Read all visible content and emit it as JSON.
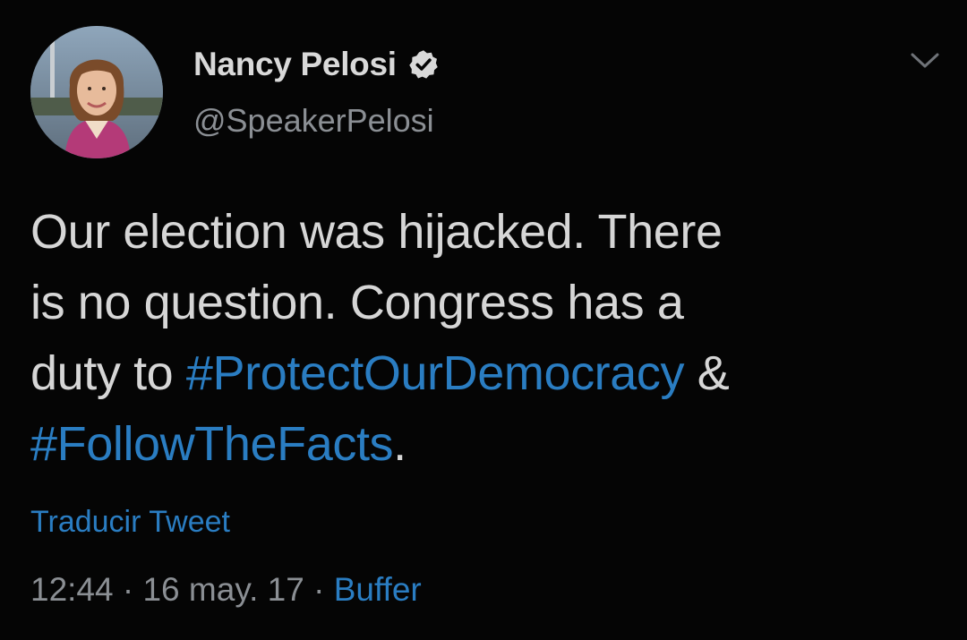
{
  "author": {
    "display_name": "Nancy Pelosi",
    "handle": "@SpeakerPelosi",
    "verified": true
  },
  "tweet": {
    "line1": "Our election was hijacked. There",
    "line2": "is no question. Congress has a",
    "line3_prefix": "duty to ",
    "hashtag1": "#ProtectOurDemocracy",
    "line3_suffix": " &",
    "hashtag2": "#FollowTheFacts",
    "line4_suffix": "."
  },
  "translate_label": "Traducir Tweet",
  "meta": {
    "time": "12:44",
    "separator": " · ",
    "date": "16 may. 17",
    "source": "Buffer"
  },
  "icons": {
    "verified": "verified-badge-icon",
    "menu": "chevron-down-icon"
  },
  "colors": {
    "background": "#050505",
    "link": "#2a7dc2",
    "text": "#d6d6d6",
    "muted": "#8b8f94"
  }
}
